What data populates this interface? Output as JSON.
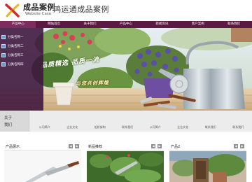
{
  "header": {
    "logo_text": "成品案例",
    "logo_sub": "Website Case",
    "site_title": "鸿运通成品案例"
  },
  "nav": [
    {
      "label": "产品中心",
      "active": true
    },
    {
      "label": "网站首页"
    },
    {
      "label": "关于我们"
    },
    {
      "label": "产品中心"
    },
    {
      "label": "新闻资讯"
    },
    {
      "label": "客户案例"
    },
    {
      "label": "联系我们"
    }
  ],
  "sidebar": {
    "items": [
      {
        "label": "分类名称一"
      },
      {
        "label": "分类名称二"
      },
      {
        "label": "分类名称三"
      },
      {
        "label": "分类名称四"
      }
    ]
  },
  "banner": {
    "slogan1": "品质精选  品质一流",
    "slogan2": "与您共创辉煌"
  },
  "about": {
    "title_line1": "关于",
    "title_line2": "我们",
    "links": [
      "公司简介",
      "企业文化",
      "组织架构",
      "联系我们",
      "公司简介",
      "企业文化",
      "联系我们",
      "联系我们"
    ]
  },
  "panels": [
    {
      "title": "产品展示"
    },
    {
      "title": "新品推荐"
    },
    {
      "title": "产品2"
    }
  ],
  "colors": {
    "nav_bg": "#5b1a44",
    "logo_red": "#d8262b",
    "logo_yellow": "#f0b21a"
  }
}
